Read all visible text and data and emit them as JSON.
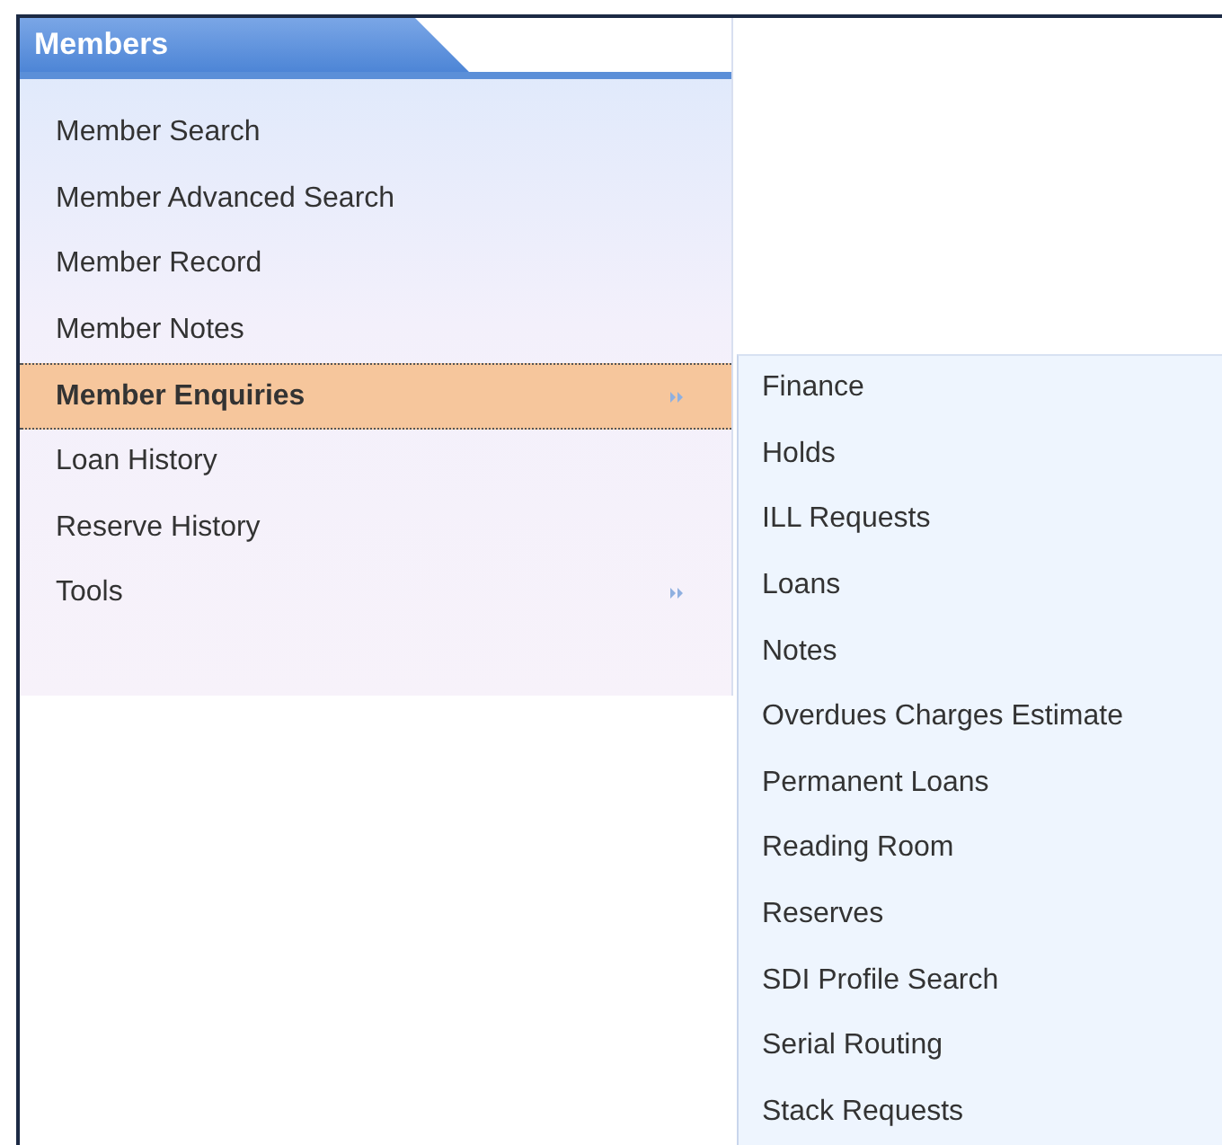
{
  "menu": {
    "title": "Members",
    "items": [
      {
        "label": "Member Search",
        "selected": false,
        "has_submenu": false
      },
      {
        "label": "Member Advanced Search",
        "selected": false,
        "has_submenu": false
      },
      {
        "label": "Member Record",
        "selected": false,
        "has_submenu": false
      },
      {
        "label": "Member Notes",
        "selected": false,
        "has_submenu": false
      },
      {
        "label": "Member Enquiries",
        "selected": true,
        "has_submenu": true
      },
      {
        "label": "Loan History",
        "selected": false,
        "has_submenu": false
      },
      {
        "label": "Reserve History",
        "selected": false,
        "has_submenu": false
      },
      {
        "label": "Tools",
        "selected": false,
        "has_submenu": true
      }
    ]
  },
  "submenu": {
    "items": [
      "Finance",
      "Holds",
      "ILL Requests",
      "Loans",
      "Notes",
      "Overdues Charges Estimate",
      "Permanent Loans",
      "Reading Room",
      "Reserves",
      "SDI Profile Search",
      "Serial Routing",
      "Stack Requests"
    ]
  }
}
